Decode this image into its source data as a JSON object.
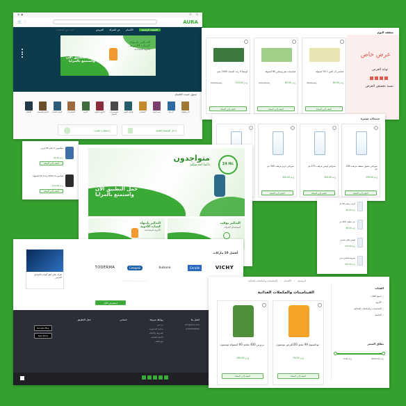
{
  "colors": {
    "bg": "#35a02f",
    "brand": "#3ba935",
    "navy": "#0c3b4b",
    "dark_footer": "#2b2e36",
    "sale_red": "#e05a52"
  },
  "header": {
    "logo": "AURA",
    "search_placeholder": "ابحث عن المنتجات",
    "nav": [
      "الصفحة الرئيسية",
      "الأقسام",
      "عن الشركة",
      "العروض"
    ]
  },
  "hero": {
    "line1": "التذكير بانتهاء",
    "line2": "كميات الأدوية",
    "line3": "الأدوية المصاحبة",
    "line4": "حمل التطبيق الآن",
    "line5": "واستمتع بالمزايا"
  },
  "categories": {
    "title": "تسوق حسب الاقسام",
    "items": [
      "الاطفال",
      "العناية الشخصية",
      "العناية بالبشرة",
      "الفيتامينات",
      "الادوية",
      "الاجهزة الطبية",
      "مستحضرات التجميل",
      "العناية بالشعر",
      "المكملات",
      "صحة المرأة",
      "الرعاية",
      "الأم والطفل"
    ]
  },
  "services": {
    "doctor": "استشارة طبيب",
    "prescription": "ادخل الوصفة الطبية"
  },
  "offers": {
    "title": "صفقة اليوم",
    "offer_label": "عرض خاص",
    "ends": "نهاية العرض",
    "discount": "نسبة تخفيض العرض",
    "products": [
      {
        "name": "فيتامين ال اكس 1 30 كبسولة",
        "price": "60.00 ج.م",
        "old": "75.00 ج.م"
      },
      {
        "name": "فيتامينات هير وسكين 60 كبسولة",
        "price": "85.00 ج.م",
        "old": "100.00 ج.م"
      },
      {
        "name": "أوميجا 3 زيت السمك 1000 مجم",
        "price": "120.00 ج.م",
        "old": "150.00 ج.م"
      }
    ],
    "add_label": "اضف إلى السلة"
  },
  "featured": {
    "title": "منتجات مميزة",
    "products": [
      {
        "name": "سيرافي غسول منظف مرطب 236 مل",
        "price": "299.00 ج.م"
      },
      {
        "name": "سيرافي لوشن مرطب 473 مل",
        "price": "350.00 ج.م"
      },
      {
        "name": "سيرافي كريم مرطب 340 جم",
        "price": "320.00 ج.م"
      },
      {
        "name": "سيرافي غسول رغوي 236 مل",
        "price": "280.00 ج.م"
      }
    ],
    "add_label": "اضف إلى السلة"
  },
  "app_banner": {
    "line1": "متواجدون",
    "line2": "دائما لخدمتكم",
    "line3": "حمل التطبيق الآن",
    "line4": "واستمتع بالمزايا",
    "badge": "24 Hr.",
    "sub1_a": "التذكير بانتهاء",
    "sub1_b": "كميات الأدوية",
    "sub1_c": "الأدوية المصاحبة",
    "sub2_a": "التذكير بوقت",
    "sub2_b": "استخدام الدواء"
  },
  "side_products": [
    {
      "name": "ميلاتونين 5 مجم 60 قرص",
      "price": "95.00 ج.م"
    },
    {
      "name": "فيتامين د3 5000 وحدة 60 كبسولة",
      "price": "110.00 ج.م"
    }
  ],
  "brands": {
    "title": "أفضل 10 ماركات",
    "items": [
      "VICHY",
      "CeraVe",
      "bubano",
      "Cetaphil",
      "TODERMA"
    ]
  },
  "blog": {
    "title": "تعرف على أهم أسباب الصداع المزمن",
    "more": "استعرض الكل"
  },
  "footer": {
    "sections": [
      "اتصل بنا",
      "روابط سريعة",
      "حسابي",
      "حمل التطبيق"
    ],
    "links": [
      "من نحن",
      "سياسة الخصوصية",
      "الشروط والأحكام",
      "الأسئلة الشائعة",
      "تتبع الطلب"
    ],
    "contact": [
      "info@aura.com",
      "01000000000"
    ],
    "google_play": "Google Play",
    "app_store": "App Store",
    "copyright": "جميع الحقوق محفوظة © AURA"
  },
  "listing": {
    "breadcrumb": [
      "الرئيسية",
      "الأقسام",
      "الفيتامينات والمكملات الغذائية"
    ],
    "title": "الفيتامينات والمكملات الغذائية",
    "filter_title": "الفئات",
    "filters": [
      "جميع الفئات",
      "الأدوية",
      "الفيتامينات والمكملات الغذائية",
      "التجميل"
    ],
    "price_title": "نطاق السعر",
    "price_min": "0.00 ج.م",
    "price_max": "9000.00 ج.م",
    "products": [
      {
        "name": "بوتاسيوم 99 مجم 100قرص توبسون",
        "price": "75.00 ج.م"
      },
      {
        "name": "بربرين 400 ملجم 60 كبسولة توبسون",
        "price": "190.00 ج.م"
      }
    ],
    "add_label": "اضف إلى السلة"
  },
  "small_list": [
    {
      "name": "كريم ترطيب 50 مل",
      "price": "45.00 ج.م"
    },
    {
      "name": "جل منظف 200 مل",
      "price": "88.00 ج.م"
    },
    {
      "name": "لوشن واقي شمس",
      "price": "130.00 ج.م"
    },
    {
      "name": "سيروم فيتامين سي",
      "price": "210.00 ج.م"
    }
  ]
}
